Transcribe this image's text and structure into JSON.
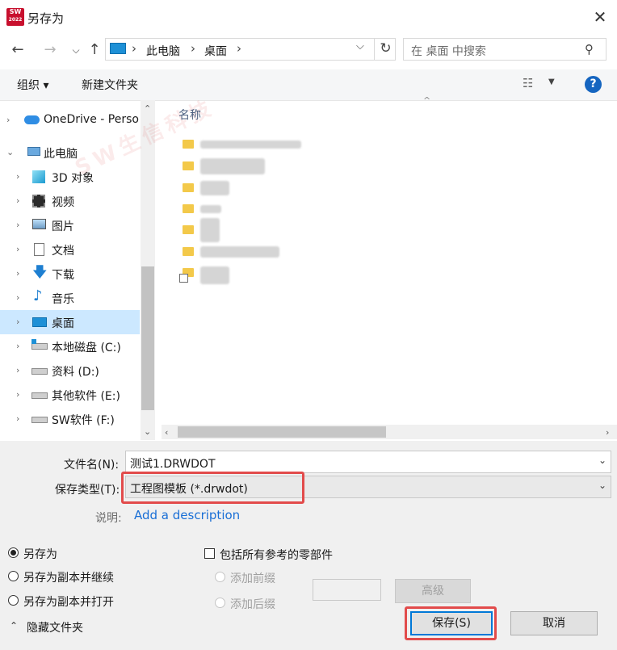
{
  "window": {
    "title": "另存为",
    "app_icon_text": [
      "SW",
      "2022"
    ]
  },
  "nav": {
    "back_icon": "arrow-left-icon",
    "forward_icon": "arrow-right-icon",
    "recent_icon": "chevron-down-icon",
    "up_icon": "arrow-up-icon",
    "breadcrumb": [
      "此电脑",
      "桌面"
    ],
    "search_placeholder": "在 桌面 中搜索"
  },
  "toolbar": {
    "organize": "组织 ▾",
    "new_folder": "新建文件夹"
  },
  "tree": [
    {
      "label": "OneDrive - Perso",
      "icon": "cloud-icon",
      "level": 0,
      "expanded": false
    },
    {
      "label": "此电脑",
      "icon": "computer-icon",
      "level": 0,
      "expanded": true
    },
    {
      "label": "3D 对象",
      "icon": "cube-icon",
      "level": 1
    },
    {
      "label": "视频",
      "icon": "video-icon",
      "level": 1
    },
    {
      "label": "图片",
      "icon": "picture-icon",
      "level": 1
    },
    {
      "label": "文档",
      "icon": "document-icon",
      "level": 1
    },
    {
      "label": "下载",
      "icon": "download-icon",
      "level": 1
    },
    {
      "label": "音乐",
      "icon": "music-icon",
      "level": 1
    },
    {
      "label": "桌面",
      "icon": "desktop-icon",
      "level": 1,
      "selected": true
    },
    {
      "label": "本地磁盘 (C:)",
      "icon": "drive-icon",
      "level": 1
    },
    {
      "label": "资料 (D:)",
      "icon": "drive-icon",
      "level": 1
    },
    {
      "label": "其他软件 (E:)",
      "icon": "drive-icon",
      "level": 1
    },
    {
      "label": "SW软件 (F:)",
      "icon": "drive-icon",
      "level": 1
    }
  ],
  "file_list": {
    "column_name": "名称"
  },
  "form": {
    "filename_label": "文件名(N):",
    "filename_value": "测试1.DRWDOT",
    "filetype_label": "保存类型(T):",
    "filetype_value": "工程图模板 (*.drwdot)",
    "description_label": "说明:",
    "description_link": "Add a description"
  },
  "options": {
    "radio_save_as": "另存为",
    "radio_save_copy_continue": "另存为副本并继续",
    "radio_save_copy_open": "另存为副本并打开",
    "include_refs": "包括所有参考的零部件",
    "add_prefix": "添加前缀",
    "add_suffix": "添加后缀",
    "advanced": "高级",
    "hide_folders": "隐藏文件夹"
  },
  "buttons": {
    "save": "保存(S)",
    "cancel": "取消"
  },
  "watermark": "SW生信科技"
}
